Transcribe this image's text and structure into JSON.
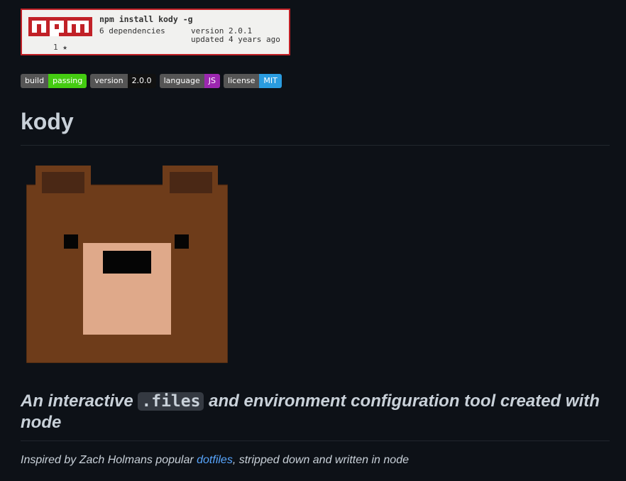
{
  "npm": {
    "logo_text": "npm",
    "stars": "1 ★",
    "command": "npm install kody -g",
    "dependencies": "6 dependencies",
    "version": "version 2.0.1",
    "updated": "updated 4 years ago",
    "brand_color": "#c12127"
  },
  "badges": [
    {
      "label": "build",
      "value": "passing",
      "color": "#44cc11"
    },
    {
      "label": "version",
      "value": "2.0.0",
      "color": "#111111"
    },
    {
      "label": "language",
      "value": "JS",
      "color": "#9c27b0"
    },
    {
      "label": "license",
      "value": "MIT",
      "color": "#2a9ce0"
    }
  ],
  "title": "kody",
  "logo_image": "bear-logo",
  "tagline": {
    "prefix": "An interactive ",
    "code": ".files",
    "suffix": " and environment configuration tool created with node"
  },
  "inspired": {
    "prefix": "Inspired by Zach Holmans popular ",
    "link": "dotfiles",
    "suffix": ", stripped down and written in node"
  }
}
